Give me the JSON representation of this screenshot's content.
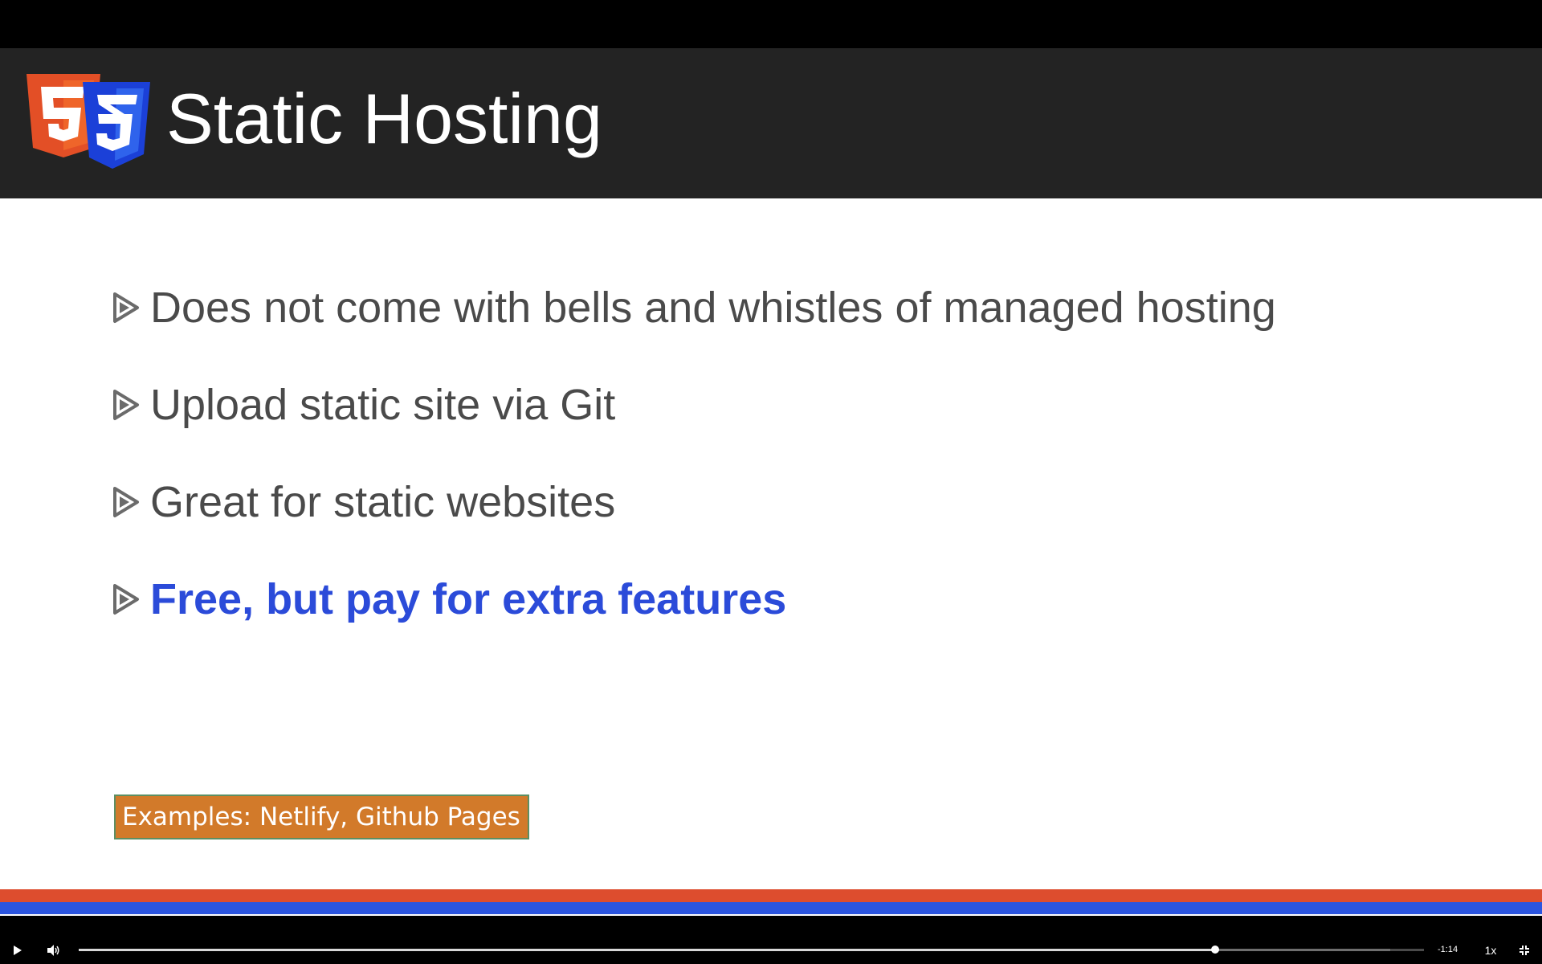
{
  "slide": {
    "title": "Static Hosting",
    "logo_icon": "html5-css3-logo",
    "bullets": [
      {
        "text": "Does not come with bells and whistles of managed hosting",
        "highlight": false
      },
      {
        "text": "Upload static site via Git",
        "highlight": false
      },
      {
        "text": "Great for static websites",
        "highlight": false
      },
      {
        "text": "Free, but pay for extra features",
        "highlight": true
      }
    ],
    "examples": "Examples: Netlify, Github Pages"
  },
  "player": {
    "play_icon": "play-icon",
    "volume_icon": "volume-icon",
    "progress_fraction": 0.845,
    "buffered_fraction": 0.975,
    "time_remaining": "-1:14",
    "speed": "1x",
    "fullscreen_icon": "exit-fullscreen-icon"
  },
  "colors": {
    "header_bg": "#232323",
    "bullet_text": "#4a4a4a",
    "highlight_text": "#2b4bd9",
    "examples_bg": "#d27a2a",
    "stripe_orange": "#dd4d2e",
    "stripe_blue": "#2b55e0"
  }
}
